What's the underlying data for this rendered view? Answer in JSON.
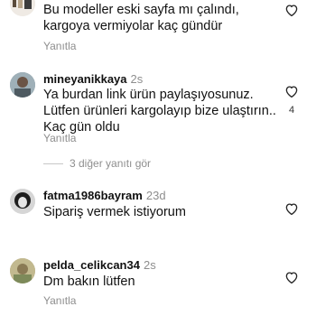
{
  "reply_label": "Yanıtla",
  "comments": [
    {
      "username": "",
      "time": "",
      "text": "Bu modeller eski sayfa mı çalındı, kargoya vermiyolar kaç gündür",
      "avatar": "avatar-user-icon",
      "likes": ""
    },
    {
      "username": "mineyanikkaya",
      "time": "2s",
      "text": "Ya burdan link ürün paylaşıyosunuz. Lütfen ürünleri kargolayıp bize ulaştırın.. Kaç gün oldu",
      "avatar": "avatar-user-icon",
      "likes": "4"
    },
    {
      "username": "fatma1986bayram",
      "time": "23d",
      "text": "Sipariş vermek istiyorum",
      "avatar": "avatar-user-icon",
      "likes": ""
    },
    {
      "username": "pelda_celikcan34",
      "time": "2s",
      "text": "Dm bakın lütfen",
      "avatar": "avatar-user-icon",
      "likes": ""
    }
  ],
  "view_replies_label": "3 diğer yanıtı gör",
  "colors": {
    "text": "#111111",
    "muted": "#8e8e8e",
    "heart_stroke": "#262626"
  }
}
